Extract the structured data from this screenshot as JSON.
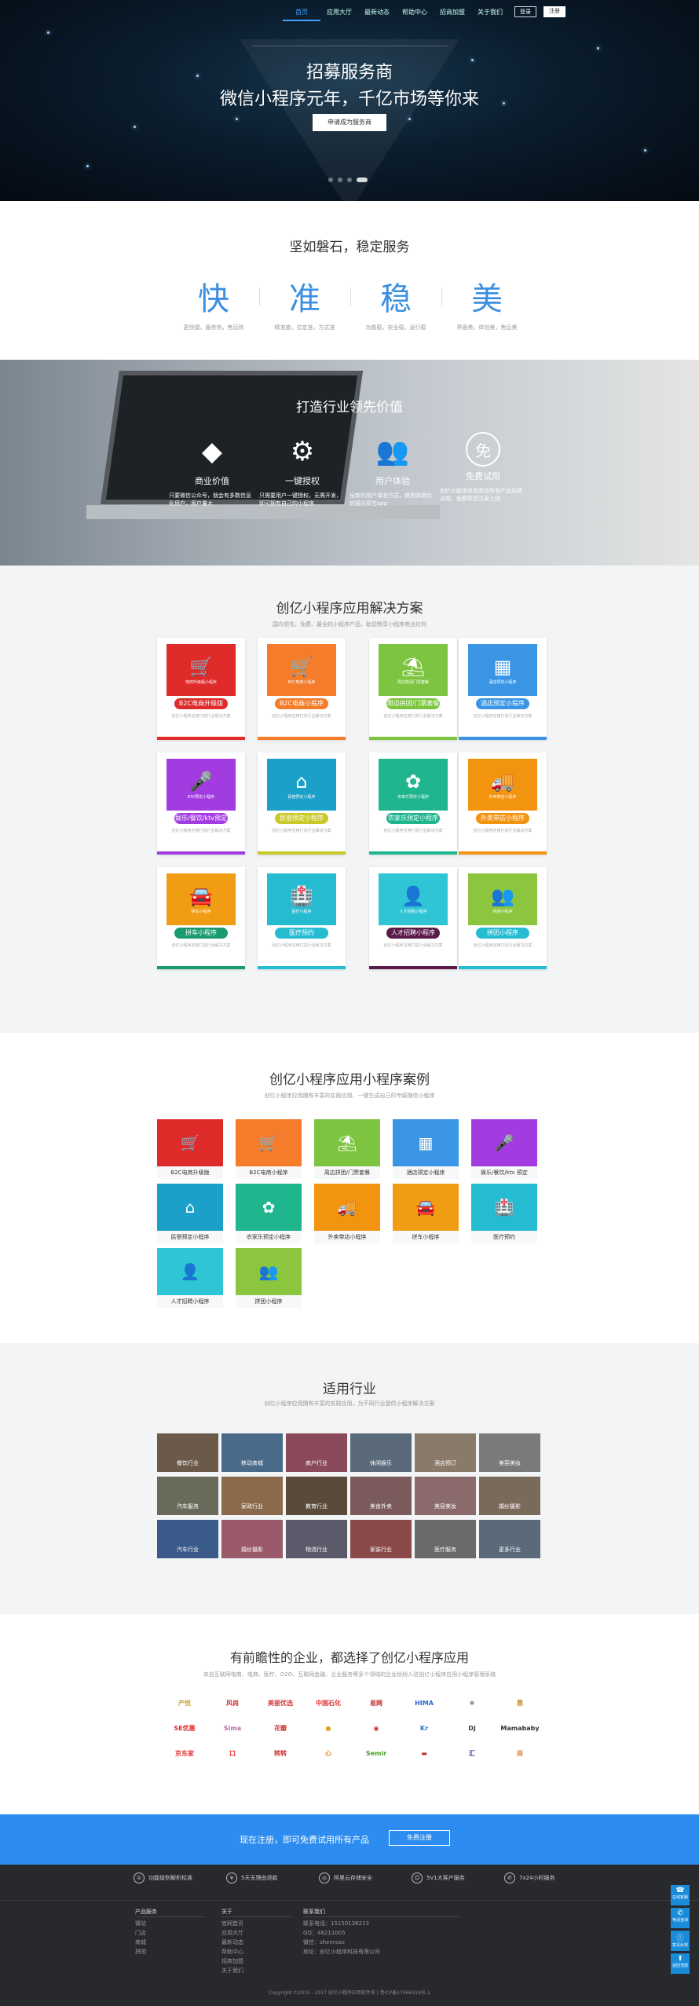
{
  "nav": {
    "items": [
      "首页",
      "应用大厅",
      "最新动态",
      "帮助中心",
      "招商加盟",
      "关于我们"
    ],
    "login": "登录",
    "register": "注册"
  },
  "hero": {
    "title": "招募服务商",
    "subtitle": "微信小程序元年，千亿市场等你来",
    "button": "申请成为服务商"
  },
  "stable": {
    "title": "坚如磐石，稳定服务",
    "items": [
      {
        "big": "快",
        "small": "更快捷，服务快，售后快"
      },
      {
        "big": "准",
        "small": "精准度，位定准，方式准"
      },
      {
        "big": "稳",
        "small": "功能稳，安全稳，运行稳"
      },
      {
        "big": "美",
        "small": "界面美，体验美，售后美"
      }
    ]
  },
  "value": {
    "title": "打造行业领先价值",
    "items": [
      {
        "icon": "diamond-icon",
        "title": "商业价值",
        "desc": "只要微信公众号，就会有多数信息化用户，用户量大"
      },
      {
        "icon": "gear-icon",
        "title": "一键授权",
        "desc": "只需要用户一键授权，无需开发，即可拥有自己的小程序"
      },
      {
        "icon": "users-icon",
        "title": "用户体验",
        "desc": "全新的用户体验方式，使用体验比较接近原生app"
      },
      {
        "icon": "free-icon",
        "title": "免费试用",
        "desc": "创亿小程序应用商店所有产品免费试用，免费帮您注册上线"
      }
    ]
  },
  "solutions": {
    "title": "创亿小程序应用解决方案",
    "subtitle": "国内领先、免费、最全的小程序产品，助您畅享小程序商业红利",
    "desc": "创亿小程序应用打造行业解决方案",
    "cards": [
      {
        "label": "B2C电商升级版",
        "cap": "电商升级版小程序",
        "glyph": "🛒",
        "color": "#e02b2b"
      },
      {
        "label": "B2C电商小程序",
        "cap": "B2C电商小程序",
        "glyph": "🛒",
        "color": "#f57c2a"
      },
      {
        "label": "周边拼团/门票套餐",
        "cap": "周边拼团门票套餐",
        "glyph": "⛱",
        "color": "#7dc540"
      },
      {
        "label": "酒店预定小程序",
        "cap": "酒店预定小程序",
        "glyph": "▦",
        "color": "#3a96e5"
      },
      {
        "label": "娱乐/餐饮/ktv预定",
        "cap": "KTV预定小程序",
        "glyph": "🎤",
        "color": "#a23ce0"
      },
      {
        "label": "民宿预定小程序",
        "cap": "民宿预定小程序",
        "glyph": "⌂",
        "color": "#1aa0c9"
      },
      {
        "label": "农家乐预定小程序",
        "cap": "农家乐预定小程序",
        "glyph": "✿",
        "color": "#1fb58f"
      },
      {
        "label": "外卖带店小程序",
        "cap": "外卖带店小程序",
        "glyph": "🚚",
        "color": "#f39411"
      },
      {
        "label": "拼车小程序",
        "cap": "拼车小程序",
        "glyph": "🚘",
        "color": "#f19d14"
      },
      {
        "label": "医疗预约",
        "cap": "医疗小程序",
        "glyph": "🏥",
        "color": "#25bcd2"
      },
      {
        "label": "人才招聘小程序",
        "cap": "人才招聘小程序",
        "glyph": "👤",
        "color": "#2fc5d4"
      },
      {
        "label": "拼团小程序",
        "cap": "拼团小程序",
        "glyph": "👥",
        "color": "#8cc63f"
      }
    ],
    "pill_colors": [
      "#e02b2b",
      "#f57c2a",
      "#7dc540",
      "#3a96e5",
      "#a23ce0",
      "#c9c92a",
      "#1fb58f",
      "#f39411",
      "#1a9b6e",
      "#25bcd2",
      "#5a1a4a",
      "#25bcd2"
    ]
  },
  "cases": {
    "title": "创亿小程序应用小程序案例",
    "subtitle": "创亿小程序应用拥有丰富的实践应用，一键生成自己的专属微信小程序",
    "items": [
      {
        "label": "B2C电商升级版",
        "glyph": "🛒",
        "color": "#e02b2b"
      },
      {
        "label": "B2C电商小程序",
        "glyph": "🛒",
        "color": "#f57c2a"
      },
      {
        "label": "周边拼团/门票套餐",
        "glyph": "⛱",
        "color": "#7dc540"
      },
      {
        "label": "酒店预定小程序",
        "glyph": "▦",
        "color": "#3a96e5"
      },
      {
        "label": "娱乐/餐饮/ktv 预定",
        "glyph": "🎤",
        "color": "#a23ce0"
      },
      {
        "label": "民宿预定小程序",
        "glyph": "⌂",
        "color": "#1aa0c9"
      },
      {
        "label": "农家乐预定小程序",
        "glyph": "✿",
        "color": "#1fb58f"
      },
      {
        "label": "外卖带店小程序",
        "glyph": "🚚",
        "color": "#f39411"
      },
      {
        "label": "拼车小程序",
        "glyph": "🚘",
        "color": "#f19d14"
      },
      {
        "label": "医疗预约",
        "glyph": "🏥",
        "color": "#25bcd2"
      },
      {
        "label": "人才招聘小程序",
        "glyph": "👤",
        "color": "#2fc5d4"
      },
      {
        "label": "拼团小程序",
        "glyph": "👥",
        "color": "#8cc63f"
      }
    ]
  },
  "industry": {
    "title": "适用行业",
    "subtitle": "创亿小程序应用拥有丰富的实践应用，为不同行业提供小程序解决方案",
    "items": [
      {
        "label": "餐饮行业",
        "color": "#6b5a4a"
      },
      {
        "label": "移动商城",
        "color": "#4a6a8a"
      },
      {
        "label": "商户行业",
        "color": "#8a4a5a"
      },
      {
        "label": "休闲娱乐",
        "color": "#5a6a7a"
      },
      {
        "label": "酒店预订",
        "color": "#8a7a6a"
      },
      {
        "label": "美容美妆",
        "color": "#7a7a7a"
      },
      {
        "label": "汽车服务",
        "color": "#6a6a5a"
      },
      {
        "label": "家政行业",
        "color": "#8a6a4a"
      },
      {
        "label": "教育行业",
        "color": "#5a4a3a"
      },
      {
        "label": "美食外卖",
        "color": "#7a5a5a"
      },
      {
        "label": "美容美妆",
        "color": "#8a6a6a"
      },
      {
        "label": "婚纱摄影",
        "color": "#7a6a5a"
      },
      {
        "label": "汽车行业",
        "color": "#3a5a8a"
      },
      {
        "label": "婚纱摄影",
        "color": "#9a5a6a"
      },
      {
        "label": "物流行业",
        "color": "#5a5a6a"
      },
      {
        "label": "家装行业",
        "color": "#8a4a4a"
      },
      {
        "label": "医疗服务",
        "color": "#6a6a6a"
      },
      {
        "label": "更多行业",
        "color": "#5a6a7a"
      }
    ]
  },
  "clients": {
    "title": "有前瞻性的企业，都选择了创亿小程序应用",
    "subtitle": "来自互联网电商、电商、医疗、O2O、互联网金融、企业服务等多个领域的企业纷纷入驻创亿小程序应用小程序管理系统",
    "logos": [
      {
        "name": "产悦",
        "color": "#c9a040"
      },
      {
        "name": "风尚",
        "color": "#d02a2a"
      },
      {
        "name": "美丽优选",
        "color": "#d63a3a"
      },
      {
        "name": "中国石化",
        "color": "#e03030"
      },
      {
        "name": "易网",
        "color": "#c02a2a"
      },
      {
        "name": "HIMA",
        "color": "#2a6ad0"
      },
      {
        "name": "✱",
        "color": "#888"
      },
      {
        "name": "鼎",
        "color": "#c08a20"
      },
      {
        "name": "SE优惠",
        "color": "#e02a2a"
      },
      {
        "name": "Sima",
        "color": "#c06aa0"
      },
      {
        "name": "花瓣",
        "color": "#d03a3a"
      },
      {
        "name": "●",
        "color": "#e0a020"
      },
      {
        "name": "◉",
        "color": "#d03030"
      },
      {
        "name": "Kr",
        "color": "#2a7ad0"
      },
      {
        "name": "DJ",
        "color": "#444"
      },
      {
        "name": "Mamababy",
        "color": "#333"
      },
      {
        "name": "京东家",
        "color": "#e03a3a"
      },
      {
        "name": "口",
        "color": "#e02020"
      },
      {
        "name": "转转",
        "color": "#d02a2a"
      },
      {
        "name": "心",
        "color": "#f08a20"
      },
      {
        "name": "Semir",
        "color": "#4aa02a"
      },
      {
        "name": "▬",
        "color": "#c02a2a"
      },
      {
        "name": "汇",
        "color": "#3a3a8a"
      },
      {
        "name": "尚",
        "color": "#e07a20"
      }
    ]
  },
  "cta": {
    "text": "现在注册，即可免费试用所有产品",
    "button": "免费注册"
  },
  "footer": {
    "features": [
      {
        "icon": "①",
        "text": "功能级别解析标准"
      },
      {
        "icon": "¥",
        "text": "5天无理由退款"
      },
      {
        "icon": "◎",
        "text": "阿里云存储安全"
      },
      {
        "icon": "☺",
        "text": "5V1大客户服务"
      },
      {
        "icon": "✆",
        "text": "7x24小时服务"
      }
    ],
    "col1": {
      "title": "产品服务",
      "items": [
        "微站",
        "门店",
        "商城",
        "拼团"
      ]
    },
    "col2": {
      "title": "关于",
      "items": [
        "官网首页",
        "应用大厅",
        "最新动态",
        "帮助中心",
        "招商加盟",
        "关于我们"
      ]
    },
    "col3": {
      "title": "联系我们",
      "items": [
        "联系电话：15150138213",
        "QQ：48211005",
        "微信：shenrsoo",
        "地址：创亿小程序科技有限公司"
      ]
    },
    "copyright": "Copyright ©2015 - 2017 创亿小程序应用软件有 | 粤ICP备17066919号-1"
  },
  "float": [
    {
      "icon": "☎",
      "label": "在线客服"
    },
    {
      "icon": "✆",
      "label": "电话咨询"
    },
    {
      "icon": "ⓘ",
      "label": "意见反馈"
    },
    {
      "icon": "⬆",
      "label": "返回顶部"
    }
  ]
}
